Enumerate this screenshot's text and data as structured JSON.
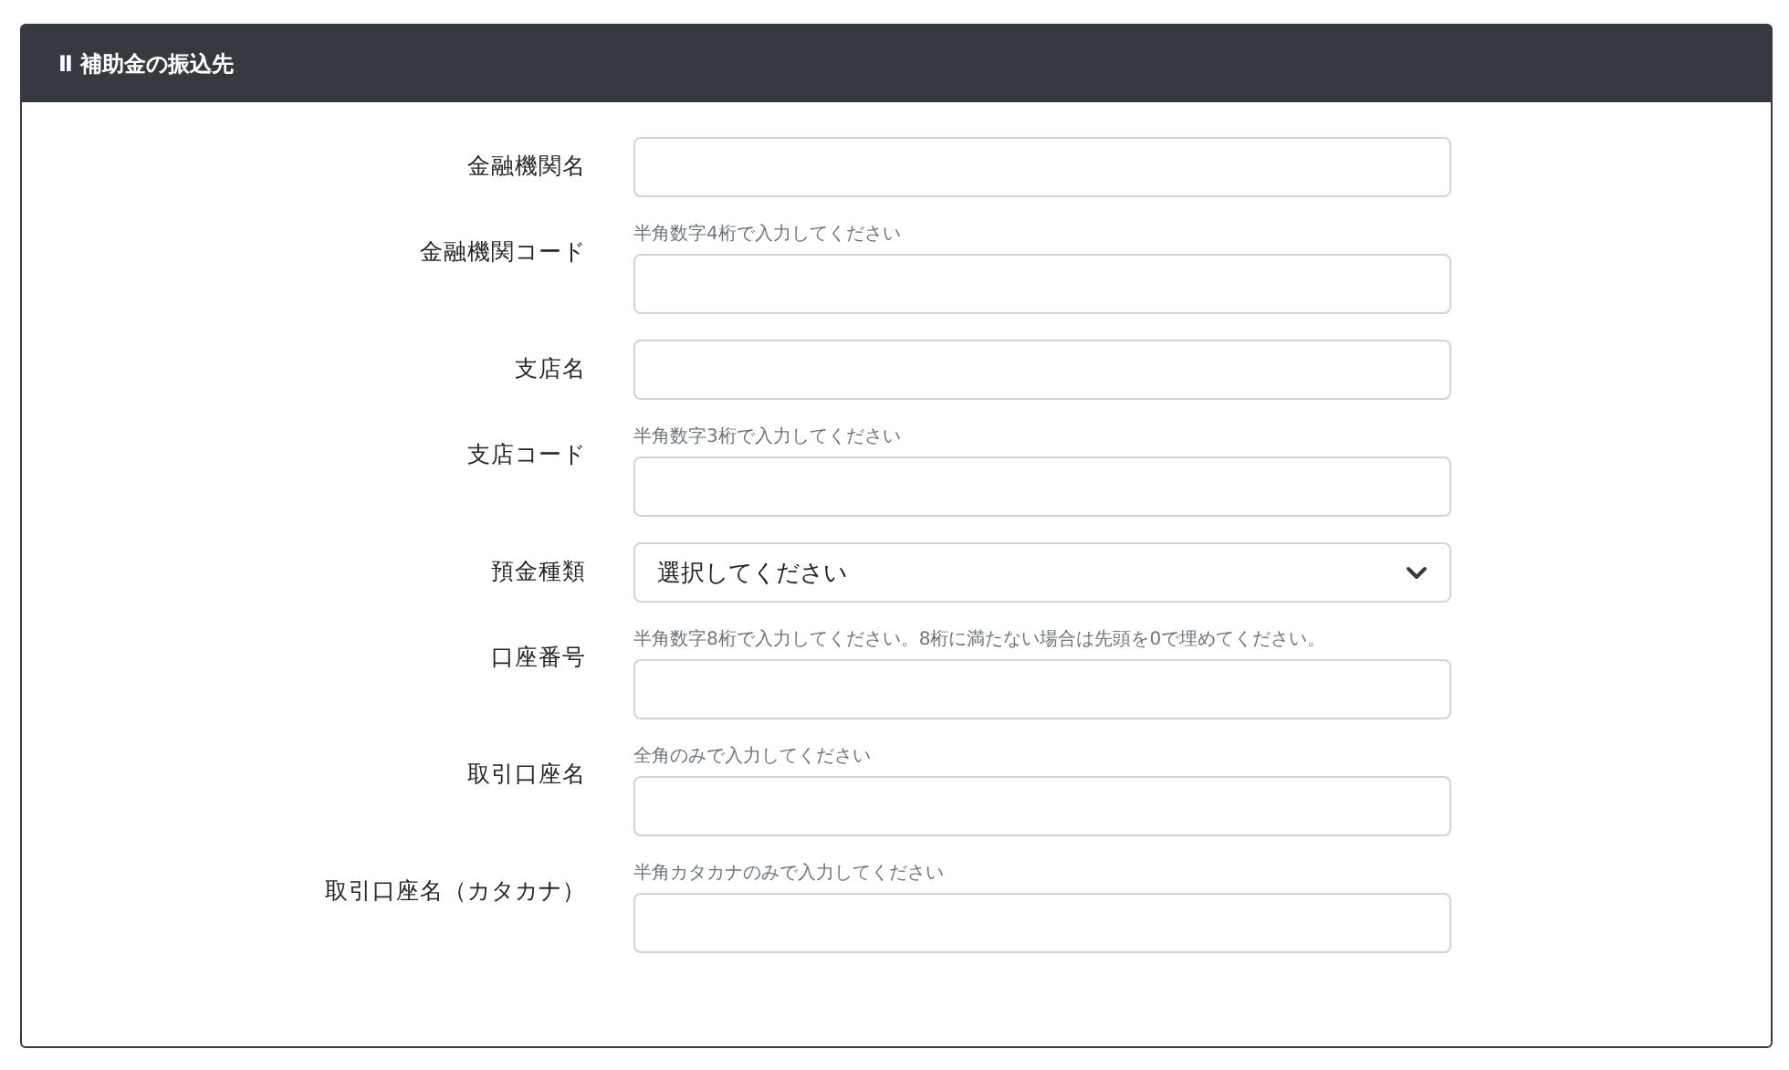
{
  "section": {
    "title": "Ⅱ 補助金の振込先"
  },
  "fields": [
    {
      "kind": "text",
      "label": "金融機関名"
    },
    {
      "kind": "text",
      "label": "金融機関コード",
      "hint": "半角数字4桁で入力してください"
    },
    {
      "kind": "text",
      "label": "支店名"
    },
    {
      "kind": "text",
      "label": "支店コード",
      "hint": "半角数字3桁で入力してください"
    },
    {
      "kind": "select",
      "label": "預金種類",
      "value": "選択してください"
    },
    {
      "kind": "text",
      "label": "口座番号",
      "hint": "半角数字8桁で入力してください。8桁に満たない場合は先頭を0で埋めてください。"
    },
    {
      "kind": "text",
      "label": "取引口座名",
      "hint": "全角のみで入力してください"
    },
    {
      "kind": "text",
      "label": "取引口座名（カタカナ）",
      "hint": "半角カタカナのみで入力してください"
    }
  ]
}
